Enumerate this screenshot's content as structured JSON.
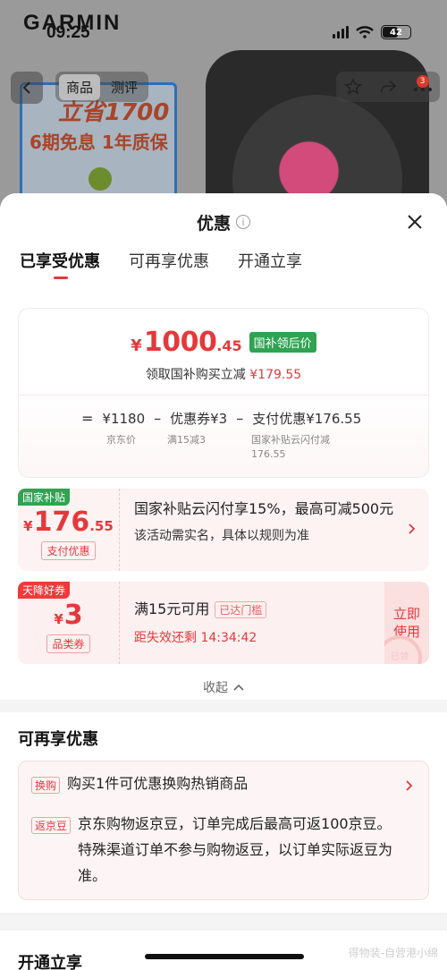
{
  "background": {
    "brand": "GARMIN",
    "status_time": "09:25",
    "battery": "42",
    "tabs": [
      "商品",
      "测评"
    ],
    "cart_badge": "3",
    "promo_line1": "立省1700",
    "promo_line2": "6期免息 1年质保"
  },
  "sheet": {
    "title": "优惠",
    "tabs": [
      "已享受优惠",
      "可再享优惠",
      "开通立享"
    ],
    "summary": {
      "currency": "¥",
      "price_int": "1000",
      "price_dec": ".45",
      "price_tag": "国补领后价",
      "subtitle_prefix": "领取国补购买立减",
      "subtitle_amount": "¥179.55",
      "calc": {
        "eq": "=",
        "jd_price": "¥1180",
        "minus1": "–",
        "coupon": "优惠券¥3",
        "minus2": "–",
        "payment": "支付优惠¥176.55",
        "note_jd": "京东价",
        "note_coupon": "满15减3",
        "note_payment": "国家补贴云闪付减 176.55"
      }
    },
    "coupon1": {
      "corner": "国家补贴",
      "currency": "¥",
      "amount_int": "176",
      "amount_dec": ".55",
      "type": "支付优惠",
      "main": "国家补贴云闪付享15%，最高可减500元",
      "sub": "该活动需实名，具体以规则为准"
    },
    "coupon2": {
      "corner": "天降好券",
      "currency": "¥",
      "amount_int": "3",
      "type": "品类券",
      "main": "满15元可用",
      "met": "已达门槛",
      "countdown": "距失效还剩 14:34:42",
      "use_button": "立即使用",
      "stamp": "已领"
    },
    "collapse": "收起",
    "reuse": {
      "title": "可再享优惠",
      "items": [
        {
          "tag": "换购",
          "text": "购买1件可优惠换购热销商品"
        },
        {
          "tag": "返京豆",
          "text": "京东购物返京豆，订单完成后最高可返100京豆。特殊渠道订单不参与购物返豆，以订单实际返豆为准。"
        }
      ]
    },
    "open": {
      "title": "开通立享"
    }
  },
  "watermark": "得物装-自营港小绵",
  "colors": {
    "accent_red": "#e4393c",
    "subsidy_green": "#2fa352"
  }
}
